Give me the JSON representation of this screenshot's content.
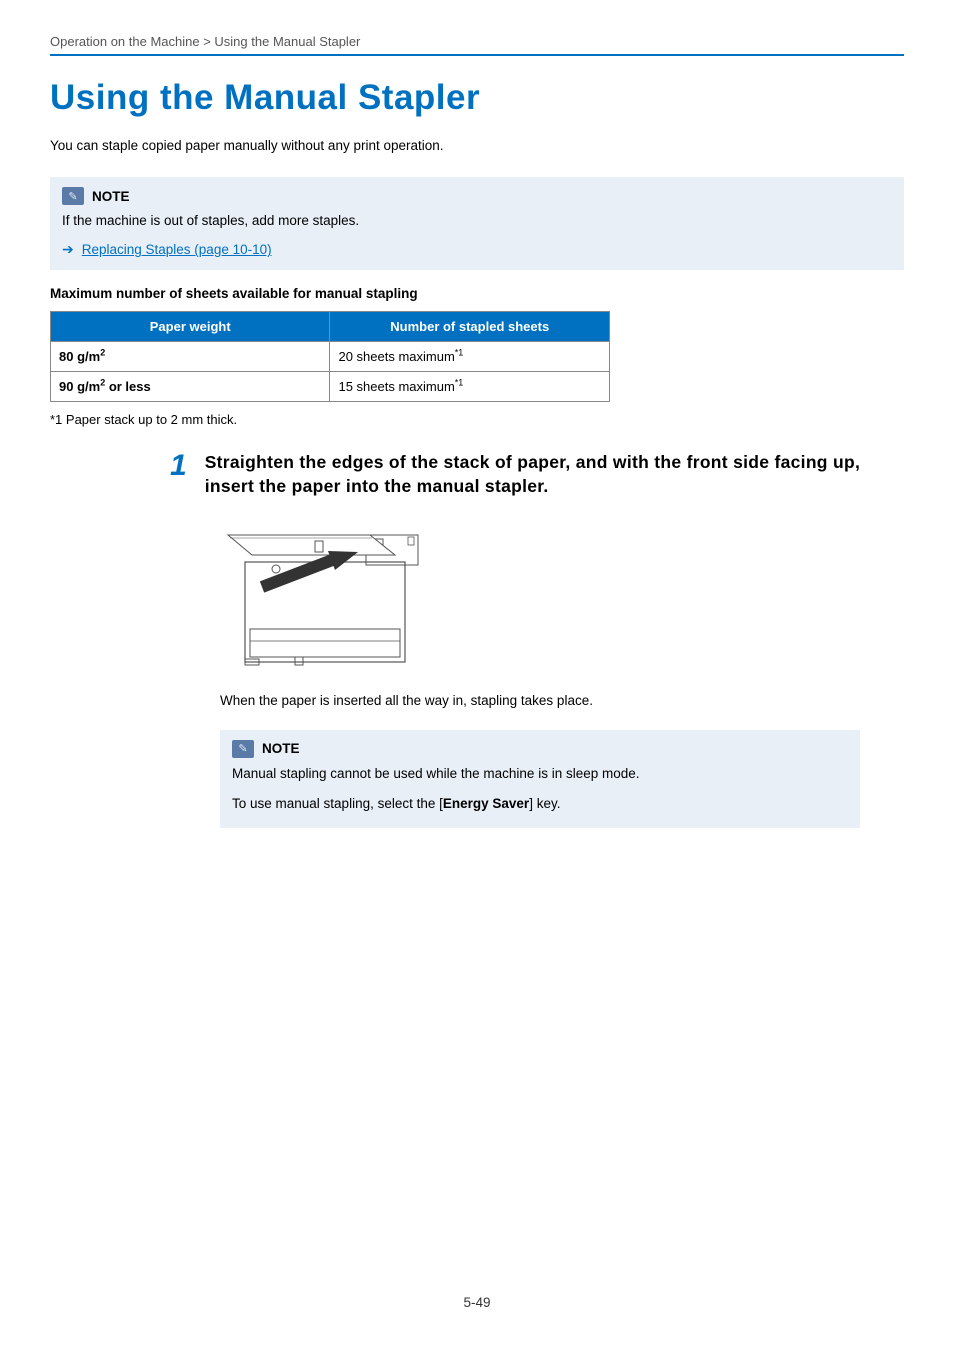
{
  "breadcrumb": "Operation on the Machine > Using the Manual Stapler",
  "title": "Using the Manual Stapler",
  "intro": "You can staple copied paper manually without any print operation.",
  "note1": {
    "label": "NOTE",
    "body": "If the machine is out of staples, add more staples.",
    "link": "Replacing Staples (page 10-10)"
  },
  "table": {
    "caption": "Maximum number of sheets available for manual stapling",
    "headers": [
      "Paper weight",
      "Number of stapled sheets"
    ],
    "rows": [
      {
        "weight_prefix": "80 g/m",
        "weight_exp": "2",
        "weight_suffix": "",
        "sheets_prefix": "20 sheets maximum",
        "sheets_exp": "*1"
      },
      {
        "weight_prefix": "90 g/m",
        "weight_exp": "2",
        "weight_suffix": " or less",
        "sheets_prefix": "15 sheets maximum",
        "sheets_exp": "*1"
      }
    ],
    "footnote": "*1   Paper stack up to 2 mm thick."
  },
  "step": {
    "number": "1",
    "heading": "Straighten the edges of the stack of paper, and with the front side facing up, insert the paper into the manual stapler.",
    "body": "When the paper is inserted all the way in, stapling takes place."
  },
  "note2": {
    "label": "NOTE",
    "line1": "Manual stapling cannot be used while the machine is in sleep mode.",
    "line2_before": "To use manual stapling, select the [",
    "line2_key": "Energy Saver",
    "line2_after": "] key."
  },
  "page_number": "5-49"
}
